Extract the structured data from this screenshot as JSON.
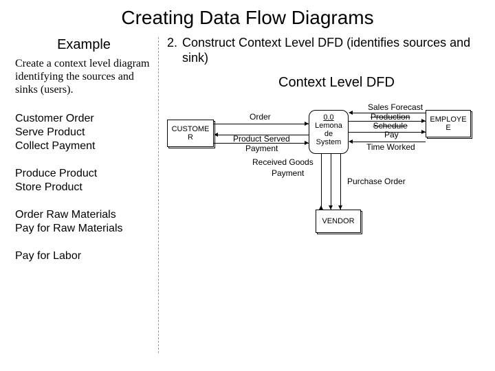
{
  "title": "Creating Data Flow Diagrams",
  "left": {
    "heading": "Example",
    "description": "Create a context level diagram identifying the sources and sinks (users).",
    "group1": [
      "Customer Order",
      "Serve Product",
      "Collect Payment"
    ],
    "group2": [
      "Produce Product",
      "Store Product"
    ],
    "group3": [
      "Order Raw Materials",
      "Pay for Raw Materials"
    ],
    "group4": [
      "Pay for Labor"
    ]
  },
  "right": {
    "step_num": "2.",
    "step_text": "Construct Context Level DFD (identifies sources and sink)",
    "sub_heading": "Context Level DFD"
  },
  "dfd": {
    "entities": {
      "customer": "CUSTOME\nR",
      "employee": "EMPLOYE\nE",
      "vendor": "VENDOR"
    },
    "process": {
      "id": "0.0",
      "name": "Lemona\nde\nSystem"
    },
    "flows": {
      "order": "Order",
      "product_served": "Product Served",
      "payment": "Payment",
      "sales_forecast": "Sales Forecast",
      "production_schedule": "Production\nSchedule",
      "pay": "Pay",
      "time_worked": "Time Worked",
      "received_goods": "Received Goods",
      "payment2": "Payment",
      "purchase_order": "Purchase Order"
    }
  }
}
